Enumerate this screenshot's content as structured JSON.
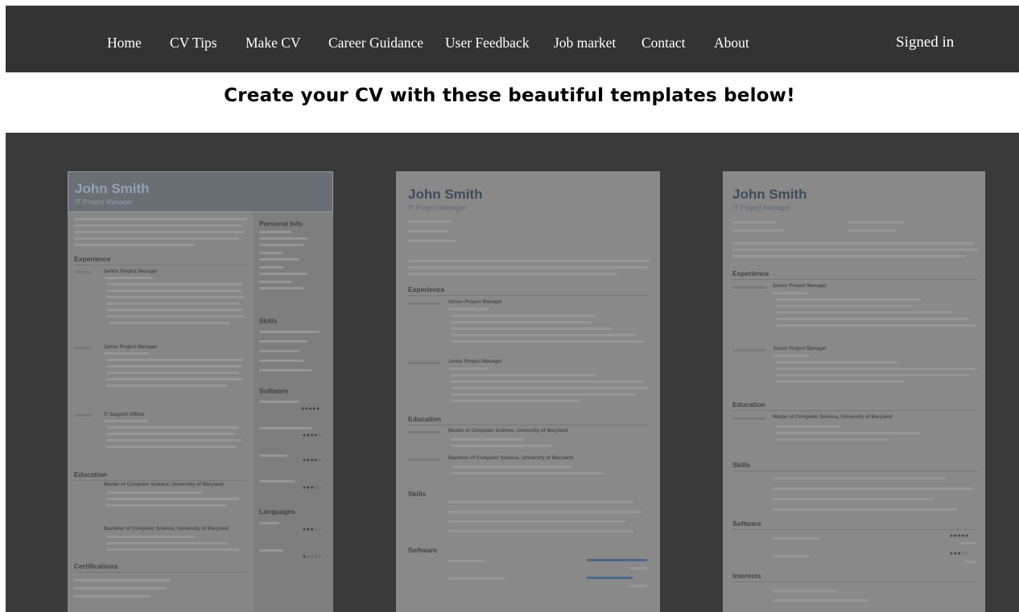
{
  "nav": {
    "items": [
      "Home",
      "CV Tips",
      "Make CV",
      "Career Guidance",
      "User Feedback",
      "Job market",
      "Contact",
      "About"
    ],
    "signed_in": "Signed in"
  },
  "headline": "Create your CV with these beautiful templates below!",
  "templates": [
    {
      "name": "John Smith",
      "role": "IT Project Manager",
      "sections": [
        "Experience",
        "Education",
        "Certifications"
      ],
      "side_sections": [
        "Personal Info",
        "Skills",
        "Software",
        "Languages"
      ],
      "jobs": [
        "Senior Project Manager",
        "Junior Project Manager",
        "IT Support Officer",
        "Master of Computer Science, University of Maryland",
        "Bachelor of Computer Science, University of Maryland"
      ]
    },
    {
      "name": "John Smith",
      "role": "IT Project Manager",
      "sections": [
        "Experience",
        "Education",
        "Skills",
        "Software"
      ],
      "jobs": [
        "Senior Project Manager",
        "Junior Project Manager",
        "Master of Computer Science, University of Maryland",
        "Bachelor of Computer Science, University of Maryland"
      ]
    },
    {
      "name": "John Smith",
      "role": "IT Project Manager",
      "sections": [
        "Experience",
        "Education",
        "Skills",
        "Software",
        "Interests"
      ],
      "jobs": [
        "Senior Project Manager",
        "Junior Project Manager",
        "Master of Computer Science, University of Maryland"
      ]
    }
  ],
  "colors": {
    "navbar": "#333333",
    "gallery": "#3a3a3a",
    "nav_text": "#ffffff"
  }
}
